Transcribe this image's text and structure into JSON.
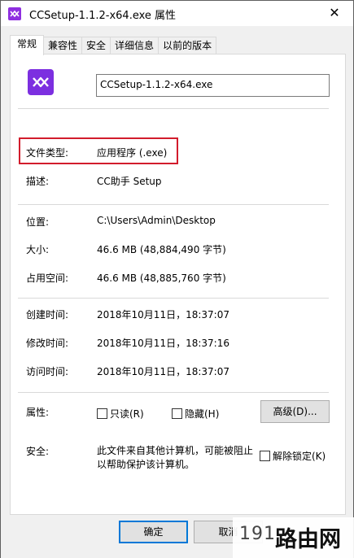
{
  "window": {
    "title": "CCSetup-1.1.2-x64.exe 属性",
    "close_glyph": "✕"
  },
  "tabs": [
    {
      "label": "常规"
    },
    {
      "label": "兼容性"
    },
    {
      "label": "安全"
    },
    {
      "label": "详细信息"
    },
    {
      "label": "以前的版本"
    }
  ],
  "file": {
    "name": "CCSetup-1.1.2-x64.exe"
  },
  "rows": {
    "file_type": {
      "label": "文件类型:",
      "value": "应用程序 (.exe)"
    },
    "description": {
      "label": "描述:",
      "value": "CC助手 Setup"
    },
    "location": {
      "label": "位置:",
      "value": "C:\\Users\\Admin\\Desktop"
    },
    "size": {
      "label": "大小:",
      "value": "46.6 MB (48,884,490 字节)"
    },
    "size_on_disk": {
      "label": "占用空间:",
      "value": "46.6 MB (48,885,760 字节)"
    },
    "created": {
      "label": "创建时间:",
      "value": "2018年10月11日，18:37:07"
    },
    "modified": {
      "label": "修改时间:",
      "value": "2018年10月11日，18:37:16"
    },
    "accessed": {
      "label": "访问时间:",
      "value": "2018年10月11日，18:37:07"
    },
    "attributes": {
      "label": "属性:"
    },
    "security": {
      "label": "安全:",
      "text_line1": "此文件来自其他计算机，可能被阻止",
      "text_line2": "以帮助保护该计算机。"
    }
  },
  "attributes": {
    "readonly_label": "只读(R)",
    "hidden_label": "隐藏(H)",
    "advanced_label": "高级(D)...",
    "unblock_label": "解除锁定(K)"
  },
  "footer": {
    "ok_label": "确定",
    "cancel_label": "取消"
  },
  "watermark": {
    "number": "191",
    "text": "路由网"
  },
  "colors": {
    "highlight_border": "#d21c2c",
    "app_icon": "#7c2fe0",
    "primary_button_border": "#0078d7"
  }
}
